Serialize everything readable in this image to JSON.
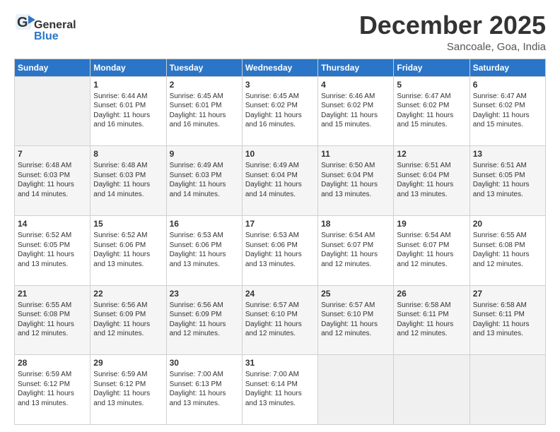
{
  "header": {
    "logo_line1": "General",
    "logo_line2": "Blue",
    "month": "December 2025",
    "location": "Sancoale, Goa, India"
  },
  "days_of_week": [
    "Sunday",
    "Monday",
    "Tuesday",
    "Wednesday",
    "Thursday",
    "Friday",
    "Saturday"
  ],
  "weeks": [
    [
      {
        "day": "",
        "content": ""
      },
      {
        "day": "1",
        "content": "Sunrise: 6:44 AM\nSunset: 6:01 PM\nDaylight: 11 hours\nand 16 minutes."
      },
      {
        "day": "2",
        "content": "Sunrise: 6:45 AM\nSunset: 6:01 PM\nDaylight: 11 hours\nand 16 minutes."
      },
      {
        "day": "3",
        "content": "Sunrise: 6:45 AM\nSunset: 6:02 PM\nDaylight: 11 hours\nand 16 minutes."
      },
      {
        "day": "4",
        "content": "Sunrise: 6:46 AM\nSunset: 6:02 PM\nDaylight: 11 hours\nand 15 minutes."
      },
      {
        "day": "5",
        "content": "Sunrise: 6:47 AM\nSunset: 6:02 PM\nDaylight: 11 hours\nand 15 minutes."
      },
      {
        "day": "6",
        "content": "Sunrise: 6:47 AM\nSunset: 6:02 PM\nDaylight: 11 hours\nand 15 minutes."
      }
    ],
    [
      {
        "day": "7",
        "content": "Sunrise: 6:48 AM\nSunset: 6:03 PM\nDaylight: 11 hours\nand 14 minutes."
      },
      {
        "day": "8",
        "content": "Sunrise: 6:48 AM\nSunset: 6:03 PM\nDaylight: 11 hours\nand 14 minutes."
      },
      {
        "day": "9",
        "content": "Sunrise: 6:49 AM\nSunset: 6:03 PM\nDaylight: 11 hours\nand 14 minutes."
      },
      {
        "day": "10",
        "content": "Sunrise: 6:49 AM\nSunset: 6:04 PM\nDaylight: 11 hours\nand 14 minutes."
      },
      {
        "day": "11",
        "content": "Sunrise: 6:50 AM\nSunset: 6:04 PM\nDaylight: 11 hours\nand 13 minutes."
      },
      {
        "day": "12",
        "content": "Sunrise: 6:51 AM\nSunset: 6:04 PM\nDaylight: 11 hours\nand 13 minutes."
      },
      {
        "day": "13",
        "content": "Sunrise: 6:51 AM\nSunset: 6:05 PM\nDaylight: 11 hours\nand 13 minutes."
      }
    ],
    [
      {
        "day": "14",
        "content": "Sunrise: 6:52 AM\nSunset: 6:05 PM\nDaylight: 11 hours\nand 13 minutes."
      },
      {
        "day": "15",
        "content": "Sunrise: 6:52 AM\nSunset: 6:06 PM\nDaylight: 11 hours\nand 13 minutes."
      },
      {
        "day": "16",
        "content": "Sunrise: 6:53 AM\nSunset: 6:06 PM\nDaylight: 11 hours\nand 13 minutes."
      },
      {
        "day": "17",
        "content": "Sunrise: 6:53 AM\nSunset: 6:06 PM\nDaylight: 11 hours\nand 13 minutes."
      },
      {
        "day": "18",
        "content": "Sunrise: 6:54 AM\nSunset: 6:07 PM\nDaylight: 11 hours\nand 12 minutes."
      },
      {
        "day": "19",
        "content": "Sunrise: 6:54 AM\nSunset: 6:07 PM\nDaylight: 11 hours\nand 12 minutes."
      },
      {
        "day": "20",
        "content": "Sunrise: 6:55 AM\nSunset: 6:08 PM\nDaylight: 11 hours\nand 12 minutes."
      }
    ],
    [
      {
        "day": "21",
        "content": "Sunrise: 6:55 AM\nSunset: 6:08 PM\nDaylight: 11 hours\nand 12 minutes."
      },
      {
        "day": "22",
        "content": "Sunrise: 6:56 AM\nSunset: 6:09 PM\nDaylight: 11 hours\nand 12 minutes."
      },
      {
        "day": "23",
        "content": "Sunrise: 6:56 AM\nSunset: 6:09 PM\nDaylight: 11 hours\nand 12 minutes."
      },
      {
        "day": "24",
        "content": "Sunrise: 6:57 AM\nSunset: 6:10 PM\nDaylight: 11 hours\nand 12 minutes."
      },
      {
        "day": "25",
        "content": "Sunrise: 6:57 AM\nSunset: 6:10 PM\nDaylight: 11 hours\nand 12 minutes."
      },
      {
        "day": "26",
        "content": "Sunrise: 6:58 AM\nSunset: 6:11 PM\nDaylight: 11 hours\nand 12 minutes."
      },
      {
        "day": "27",
        "content": "Sunrise: 6:58 AM\nSunset: 6:11 PM\nDaylight: 11 hours\nand 13 minutes."
      }
    ],
    [
      {
        "day": "28",
        "content": "Sunrise: 6:59 AM\nSunset: 6:12 PM\nDaylight: 11 hours\nand 13 minutes."
      },
      {
        "day": "29",
        "content": "Sunrise: 6:59 AM\nSunset: 6:12 PM\nDaylight: 11 hours\nand 13 minutes."
      },
      {
        "day": "30",
        "content": "Sunrise: 7:00 AM\nSunset: 6:13 PM\nDaylight: 11 hours\nand 13 minutes."
      },
      {
        "day": "31",
        "content": "Sunrise: 7:00 AM\nSunset: 6:14 PM\nDaylight: 11 hours\nand 13 minutes."
      },
      {
        "day": "",
        "content": ""
      },
      {
        "day": "",
        "content": ""
      },
      {
        "day": "",
        "content": ""
      }
    ]
  ]
}
